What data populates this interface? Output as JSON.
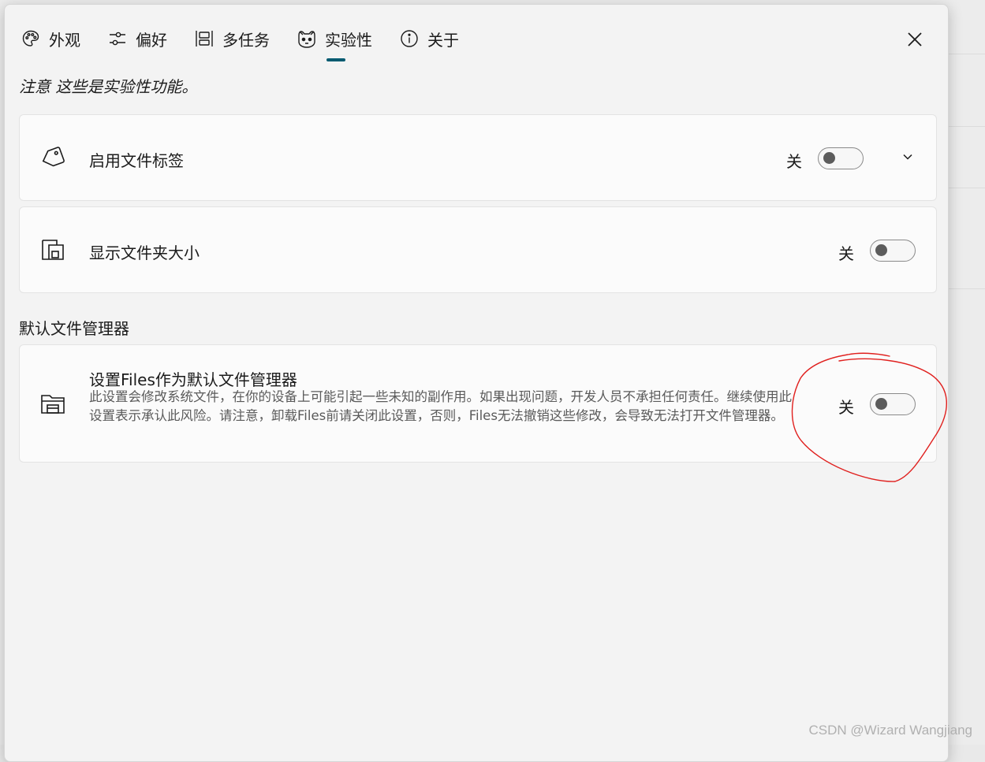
{
  "tabs": [
    {
      "label": "外观",
      "icon": "palette-icon"
    },
    {
      "label": "偏好",
      "icon": "sliders-icon"
    },
    {
      "label": "多任务",
      "icon": "multitask-icon"
    },
    {
      "label": "实验性",
      "icon": "experimental-icon",
      "selected": true
    },
    {
      "label": "关于",
      "icon": "info-icon"
    }
  ],
  "notice": "注意 这些是实验性功能。",
  "settings": {
    "file_tags": {
      "title": "启用文件标签",
      "state": "关",
      "icon": "tag-icon"
    },
    "folder_size": {
      "title": "显示文件夹大小",
      "state": "关",
      "icon": "folder-size-icon"
    }
  },
  "section": {
    "title": "默认文件管理器"
  },
  "default_manager": {
    "title": "设置Files作为默认文件管理器",
    "description": "此设置会修改系统文件，在你的设备上可能引起一些未知的副作用。如果出现问题，开发人员不承担任何责任。继续使用此设置表示承认此风险。请注意，卸载Files前请关闭此设置，否则，Files无法撤销这些修改，会导致无法打开文件管理器。",
    "state": "关",
    "icon": "file-explorer-icon"
  },
  "watermark": "CSDN @Wizard Wangjiang",
  "colors": {
    "accent": "#005a70",
    "annotation": "#e0201e",
    "background": "#f3f3f3",
    "card": "#fbfbfb"
  }
}
